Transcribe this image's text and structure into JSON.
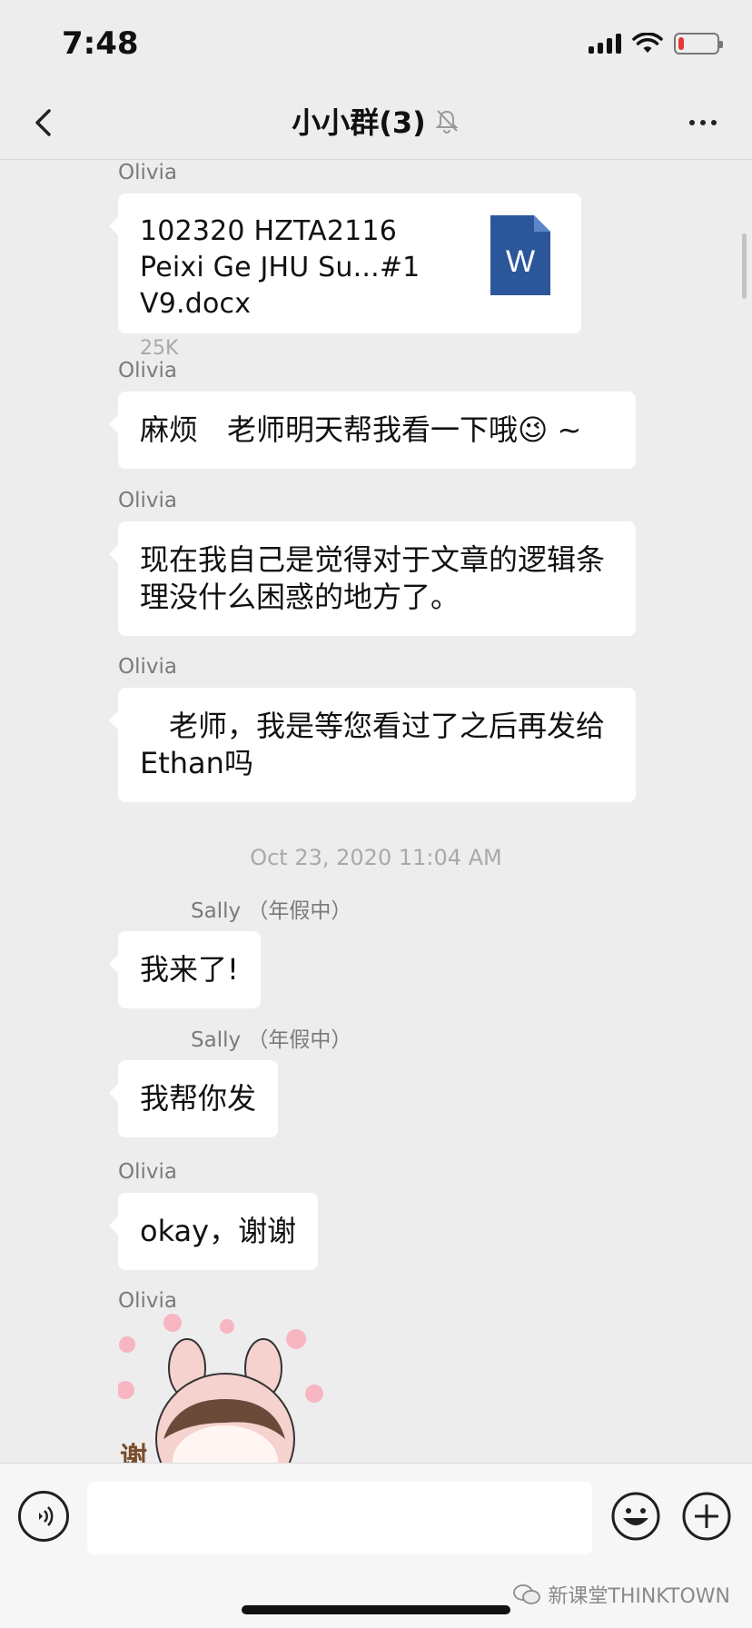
{
  "status_bar": {
    "time": "7:48",
    "battery_level": 0.15,
    "battery_color": "#e53935"
  },
  "header": {
    "title": "小小群(3)",
    "back_icon": "chevron-left-icon",
    "mute_icon": "bell-muted-icon",
    "more_icon": "more-dots-icon"
  },
  "messages": [
    {
      "sender": "Olivia",
      "type": "file",
      "file_name": "102320 HZTA2116 Peixi Ge JHU Su...#1 V9.docx",
      "file_size": "25K",
      "file_icon_label": "W",
      "file_icon_color": "#2b579a"
    },
    {
      "sender": "Olivia",
      "type": "text",
      "text": "麻烦　老师明天帮我看一下哦😉 ~"
    },
    {
      "sender": "Olivia",
      "type": "text",
      "text": "现在我自己是觉得对于文章的逻辑条理没什么困惑的地方了。"
    },
    {
      "sender": "Olivia",
      "type": "text",
      "text": "　老师，我是等您看过了之后再发给Ethan吗"
    }
  ],
  "timestamp": "Oct 23, 2020 11:04 AM",
  "messages_after": [
    {
      "sender": "Sally",
      "status": "（年假中）",
      "type": "text",
      "text": "我来了!"
    },
    {
      "sender": "Sally",
      "status": "（年假中）",
      "type": "text",
      "text": "我帮你发"
    },
    {
      "sender": "Olivia",
      "type": "text",
      "text": "okay，谢谢"
    },
    {
      "sender": "Olivia",
      "type": "sticker",
      "sticker_text": "谢"
    }
  ],
  "input_bar": {
    "placeholder": "",
    "voice_icon": "voice-icon",
    "emoji_icon": "emoji-icon",
    "plus_icon": "plus-icon"
  },
  "watermark": "新课堂THINKTOWN",
  "watermark_icon": "wechat-icon"
}
